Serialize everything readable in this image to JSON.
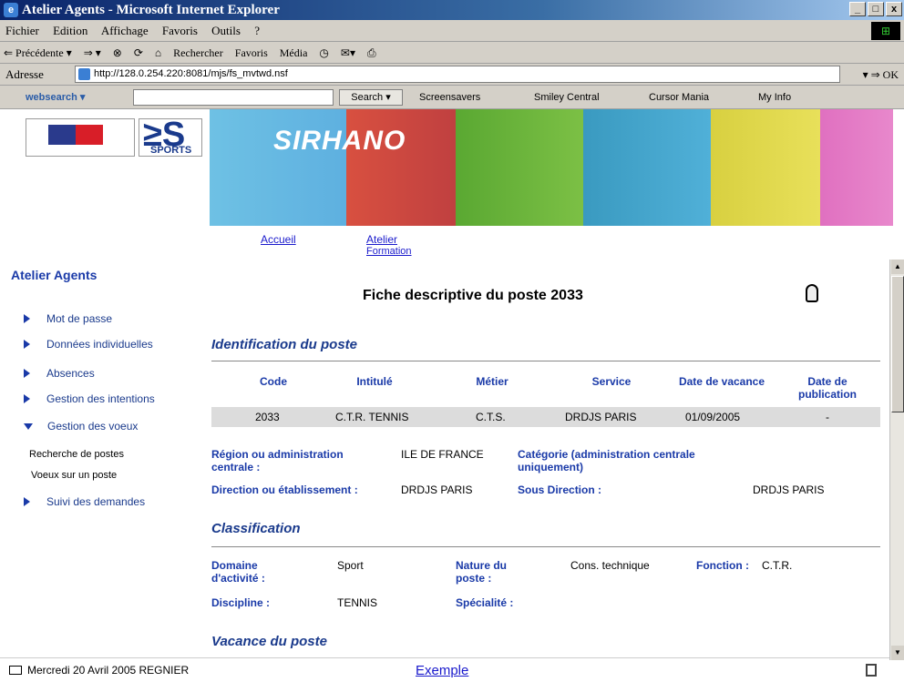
{
  "window": {
    "title": "Atelier Agents - Microsoft Internet Explorer",
    "min": "_",
    "max": "□",
    "close": "x"
  },
  "menu": [
    "Fichier",
    "Edition",
    "Affichage",
    "Favoris",
    "Outils",
    "?"
  ],
  "toolbar": {
    "back": "⇐ Précédente ▾",
    "fwd": "⇒ ▾",
    "search": "Rechercher",
    "favorites": "Favoris",
    "media": "Média"
  },
  "address": {
    "label": "Adresse",
    "url": "http://128.0.254.220:8081/mjs/fs_mvtwd.nsf",
    "ok": "OK"
  },
  "links": {
    "websearch": "websearch ▾",
    "search_btn": "Search ▾",
    "items": [
      "Screensavers",
      "Smiley Central",
      "Cursor Mania",
      "My Info"
    ]
  },
  "banner": {
    "sirhano": "SIRHANO",
    "sports": "SPORTS"
  },
  "nav": {
    "accueil": "Accueil",
    "atelier1": "Atelier",
    "atelier2": "Formation"
  },
  "sidebar": {
    "title": "Atelier Agents",
    "items": [
      "Mot de passe",
      "Données individuelles",
      "Absences",
      "Gestion des intentions",
      "Gestion des voeux"
    ],
    "subitems": [
      "Recherche de postes",
      "Voeux sur un poste"
    ],
    "last": "Suivi des demandes"
  },
  "page": {
    "title": "Fiche descriptive du poste 2033"
  },
  "identification": {
    "heading": "Identification du poste",
    "headers": [
      "Code",
      "Intitulé",
      "Métier",
      "Service",
      "Date de vacance",
      "Date de",
      "publication"
    ],
    "row": [
      "2033",
      "C.T.R. TENNIS",
      "C.T.S.",
      "DRDJS PARIS",
      "01/09/2005",
      "-"
    ],
    "region_label1": "Région ou administration",
    "region_label2": "centrale :",
    "region_value": "ILE DE FRANCE",
    "categorie_label1": "Catégorie (administration centrale",
    "categorie_label2": "uniquement)",
    "direction_label": "Direction ou établissement :",
    "direction_value": "DRDJS PARIS",
    "sousdir_label": "Sous Direction :",
    "sousdir_value": "DRDJS PARIS"
  },
  "classification": {
    "heading": "Classification",
    "domaine_label1": "Domaine",
    "domaine_label2": "d'activité :",
    "domaine_value": "Sport",
    "nature_label1": "Nature du",
    "nature_label2": "poste :",
    "nature_value": "Cons. technique",
    "fonction_label": "Fonction :",
    "fonction_value": "C.T.R.",
    "discipline_label": "Discipline :",
    "discipline_value": "TENNIS",
    "specialite_label": "Spécialité :"
  },
  "vacance": {
    "heading": "Vacance du poste"
  },
  "footer": {
    "date": "Mercredi 20 Avril 2005   REGNIER",
    "link": "Exemple"
  }
}
